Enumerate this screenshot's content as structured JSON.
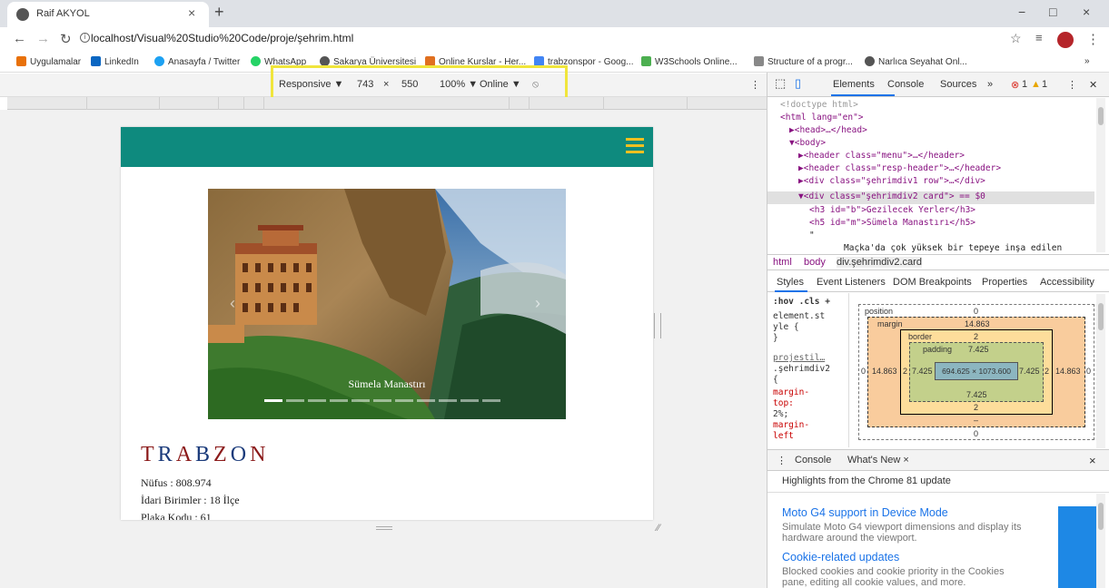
{
  "browser": {
    "tab_title": "Raif AKYOL",
    "tab_close": "×",
    "new_tab": "+",
    "url": "localhost/Visual%20Studio%20Code/proje/şehrim.html",
    "win_min": "−",
    "win_max": "□",
    "win_close": "×"
  },
  "bookmarks": [
    {
      "label": "Uygulamalar",
      "color": "#e8710a"
    },
    {
      "label": "LinkedIn",
      "color": "#0a66c2"
    },
    {
      "label": "Anasayfa / Twitter",
      "color": "#1da1f2"
    },
    {
      "label": "WhatsApp",
      "color": "#25d366"
    },
    {
      "label": "Sakarya Üniversitesi",
      "color": "#555555"
    },
    {
      "label": "Online Kurslar - Her...",
      "color": "#e07020"
    },
    {
      "label": "trabzonspor - Goog...",
      "color": "#4285f4"
    },
    {
      "label": "W3Schools Online...",
      "color": "#4caf50"
    },
    {
      "label": "Structure of a progr...",
      "color": "#888888"
    },
    {
      "label": "Narlıca Seyahat Onl...",
      "color": "#555555"
    }
  ],
  "bookmarks_more": "»",
  "device_toolbar": {
    "mode": "Responsive ▼",
    "width": "743",
    "times": "×",
    "height": "550",
    "zoom": "100% ▼",
    "network": "Online ▼",
    "rotate": "⦸"
  },
  "site": {
    "caption": "Sümela Manastırı",
    "city_letters": [
      "T",
      "R",
      "A",
      "B",
      "Z",
      "O",
      "N"
    ],
    "city_colors": [
      "#8b1a1a",
      "#1a3a7a",
      "#8b1a1a",
      "#1a3a7a",
      "#8b1a1a",
      "#1a3a7a",
      "#8b1a1a"
    ],
    "info": [
      "Nüfus : 808.974",
      "İdari Birimler : 18 İlçe",
      "Plaka Kodu : 61"
    ]
  },
  "devtools": {
    "tabs": [
      "Elements",
      "Console",
      "Sources",
      "»"
    ],
    "errors": "1",
    "warnings": "1",
    "code_lines": [
      {
        "indent": 0,
        "html": "<!doctype html>"
      },
      {
        "indent": 0,
        "html": "<html lang=\"en\">"
      },
      {
        "indent": 1,
        "html": "▶<head>…</head>"
      },
      {
        "indent": 1,
        "html": "▼<body>"
      },
      {
        "indent": 2,
        "html": "▶<header class=\"menu\">…</header>"
      },
      {
        "indent": 2,
        "html": "▶<header class=\"resp-header\">…</header>"
      },
      {
        "indent": 2,
        "html": "▶<div class=\"şehrimdiv1 row\">…</div>"
      },
      {
        "indent": 2,
        "html": "▼<div class=\"şehrimdiv2 card\"> == $0"
      },
      {
        "indent": 3,
        "html": "<h3 id=\"b\">Gezilecek Yerler</h3>"
      },
      {
        "indent": 3,
        "html": "<h5 id=\"m\">Sümela Manastırı</h5>"
      },
      {
        "indent": 3,
        "html": "\""
      },
      {
        "indent": 4,
        "html": "Maçka'da çok yüksek bir tepeye inşa edilen"
      }
    ],
    "crumbs": [
      "html",
      "body",
      "div.şehrimdiv2.card"
    ],
    "style_tabs": [
      "Styles",
      "Event Listeners",
      "DOM Breakpoints",
      "Properties",
      "Accessibility"
    ],
    "styles_lines": [
      ":hov .cls  +",
      "element.st",
      "yle {",
      "}",
      "projestil…",
      ".şehrimdiv2",
      "{",
      "  margin-",
      "    top:",
      "    2%;",
      "  margin-",
      "    left"
    ],
    "box": {
      "position_label": "position",
      "position_val": "0",
      "margin_label": "margin",
      "margin_val": "14.863",
      "border_label": "border",
      "border_val": "2",
      "padding_label": "padding",
      "padding_val": "7.425",
      "content": "694.625 × 1073.600",
      "left_pos": "0",
      "left_margin": "14.863",
      "left_border": "2",
      "left_padding": "7.425",
      "right_padding": "7.425",
      "right_border": "2",
      "right_margin": "14.863",
      "right_pos": "0",
      "bottom_padding": "7.425",
      "bottom_border": "2",
      "bottom_margin": "–",
      "bottom_pos": "0"
    },
    "drawer_tabs": [
      "Console",
      "What's New ×"
    ],
    "drawer_close": "×",
    "drawer_heading": "Highlights from the Chrome 81 update",
    "whats_new": [
      {
        "title": "Moto G4 support in Device Mode",
        "desc": "Simulate Moto G4 viewport dimensions and display its hardware around the viewport."
      },
      {
        "title": "Cookie-related updates",
        "desc": "Blocked cookies and cookie priority in the Cookies pane, editing all cookie values, and more."
      }
    ]
  }
}
